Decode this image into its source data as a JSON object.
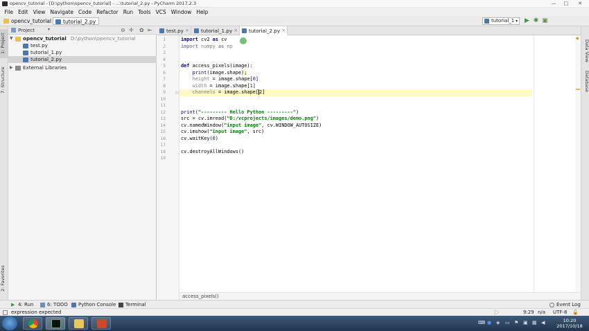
{
  "window": {
    "title": "opencv_tutorial - [D:\\python\\opencv_tutorial] - ...\\tutorial_2.py - PyCharm 2017.2.3",
    "controls": [
      "—",
      "□",
      "✕"
    ]
  },
  "menu": [
    "File",
    "Edit",
    "View",
    "Navigate",
    "Code",
    "Refactor",
    "Run",
    "Tools",
    "VCS",
    "Window",
    "Help"
  ],
  "navbar": {
    "crumbs": [
      "opencv_tutorial",
      "tutorial_2.py"
    ],
    "run_config": "tutorial_1"
  },
  "left_strip": {
    "top_tab": "1: Project",
    "mid_tab": "7: Structure",
    "bottom_tab": "2: Favorites"
  },
  "project_panel": {
    "header": "Project",
    "tree": [
      {
        "label": "opencv_tutorial",
        "path": "D:\\python\\opencv_tutorial",
        "type": "folder"
      },
      {
        "label": "test.py",
        "type": "py"
      },
      {
        "label": "tutorial_1.py",
        "type": "py"
      },
      {
        "label": "tutorial_2.py",
        "type": "py"
      },
      {
        "label": "External Libraries",
        "type": "lib"
      }
    ]
  },
  "editor": {
    "tabs": [
      "test.py",
      "tutorial_1.py",
      "tutorial_2.py"
    ],
    "active_tab": "tutorial_2.py",
    "line_numbers": [
      "1",
      "2",
      "3",
      "4",
      "5",
      "6",
      "7",
      "8",
      "9",
      "10",
      "11",
      "12",
      "13",
      "14",
      "15",
      "16",
      "17",
      "18",
      "19"
    ],
    "breadcrumb": "access_pixels()"
  },
  "right_strip": {
    "tab1": "Data View",
    "tab2": "Database"
  },
  "bottom_tools": [
    "4: Run",
    "6: TODO",
    "Python Console",
    "Terminal"
  ],
  "event_log": "Event Log",
  "status": {
    "message": "expression expected",
    "position": "9:29",
    "separator": "n/a",
    "encoding": "UTF-8 "
  },
  "taskbar": {
    "time": "10:20",
    "date": "2017/10/18"
  },
  "watermark": "  "
}
